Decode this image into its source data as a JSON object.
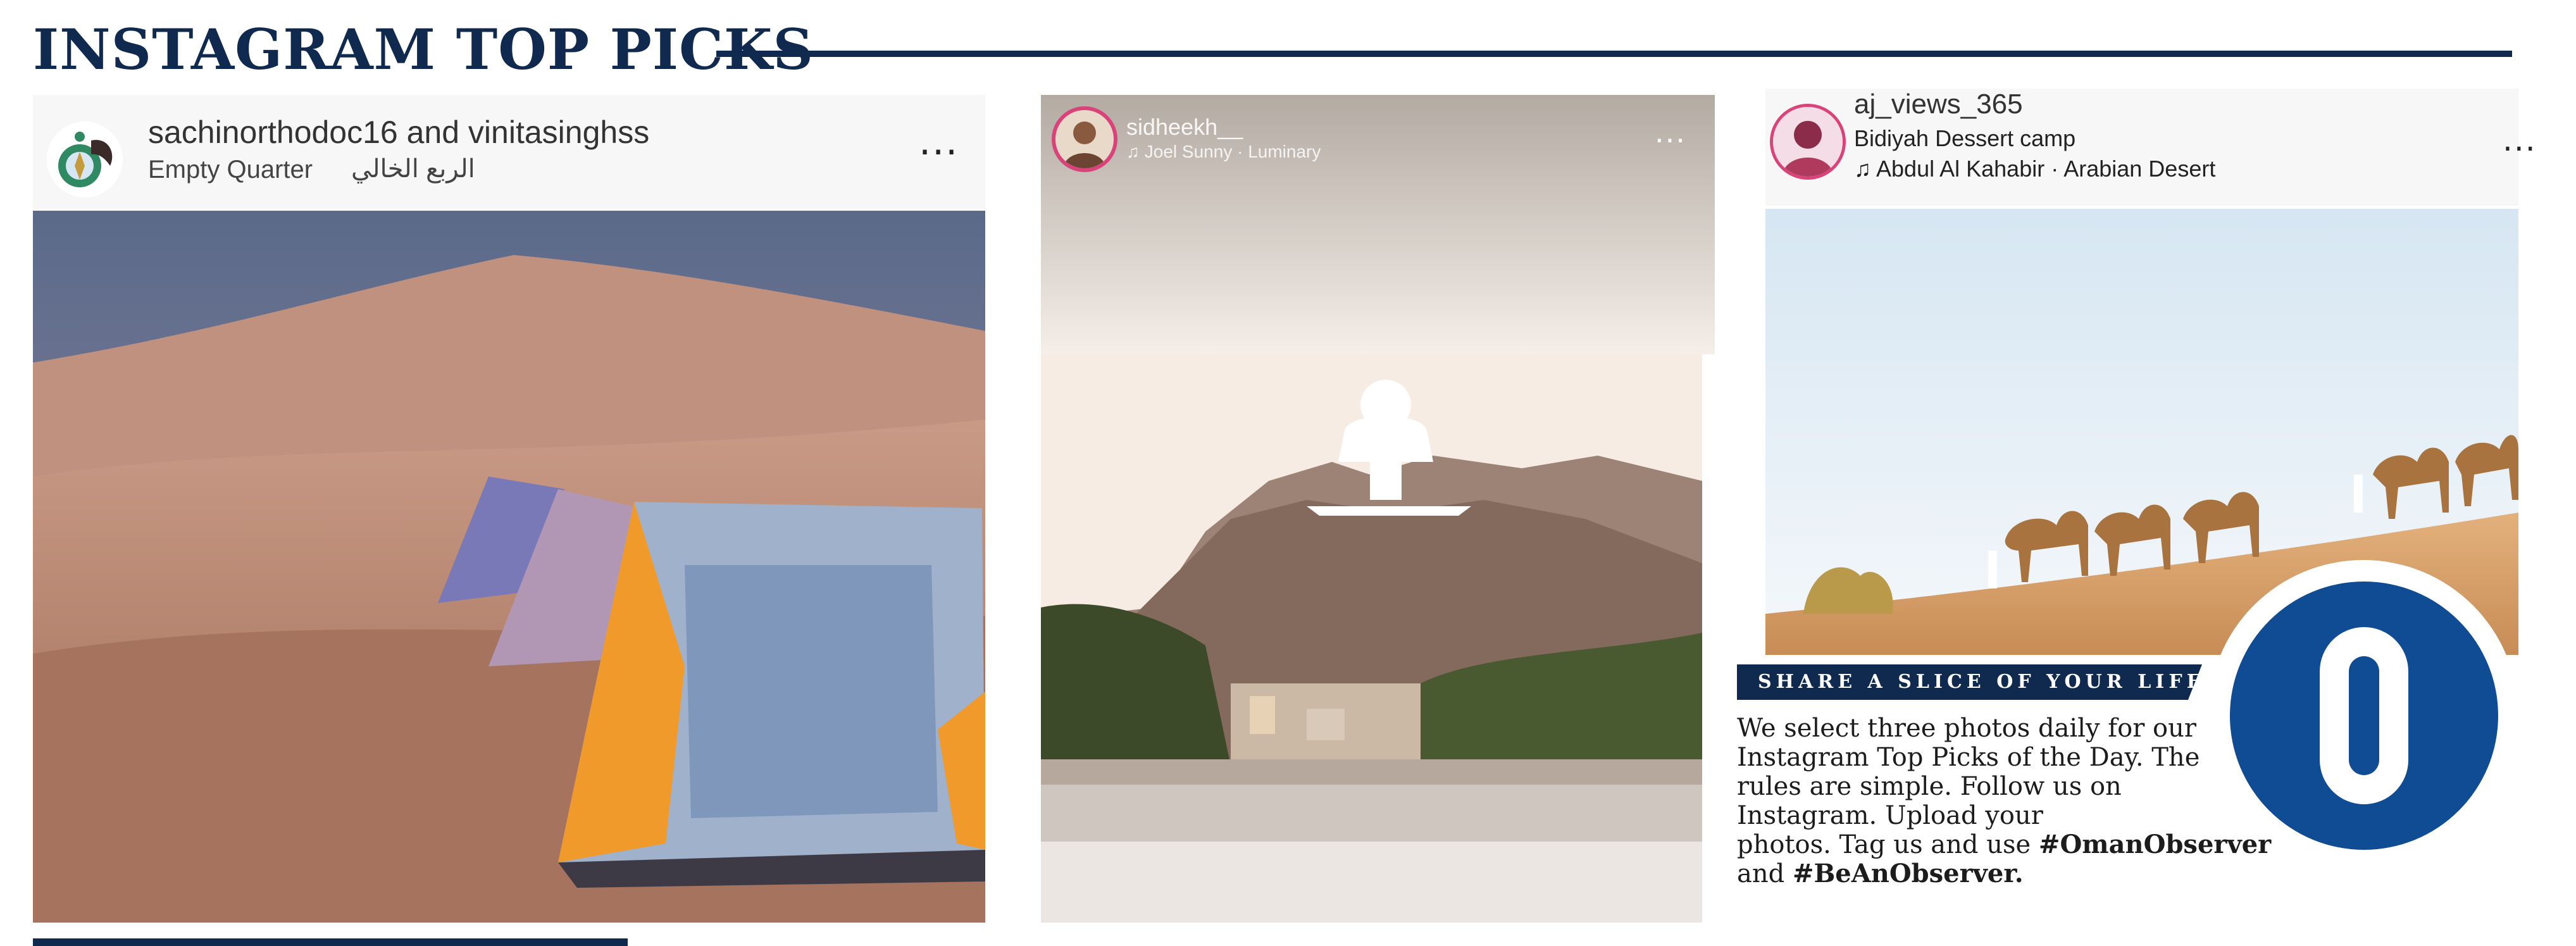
{
  "header": {
    "title": "INSTAGRAM TOP PICKS"
  },
  "posts": [
    {
      "username": "sachinorthodoc16 and vinitasinghss",
      "location": "Empty Quarter",
      "location_ar": "الربع الخالي",
      "menu": "...",
      "image": "desert-camp-tents-photo"
    },
    {
      "username": "sidheekh__",
      "music": "Joel Sunny · Luminary",
      "menu": "...",
      "image": "muscat-incense-burner-monument-photo"
    },
    {
      "username": "aj_views_365",
      "location": "Bidiyah Dessert camp",
      "music": "Abdul Al Kahabir · Arabian Desert",
      "menu": "...",
      "image": "camel-caravan-dune-photo"
    }
  ],
  "share": {
    "heading": "SHARE A SLICE OF YOUR LIFE",
    "lines": [
      "We select three photos daily for our",
      "Instagram Top Picks of the Day. The",
      "rules are simple. Follow us on",
      "Instagram. Upload your"
    ],
    "line5_plain": "photos. Tag us and use ",
    "hashtag1": "#OmanObserver",
    "line6_plain": "and ",
    "hashtag2": "#BeAnObserver."
  },
  "logo": {
    "letter": "O",
    "color": "#0f4c93"
  },
  "colors": {
    "navy": "#0f2a4e",
    "logo_blue": "#0f4c93"
  }
}
